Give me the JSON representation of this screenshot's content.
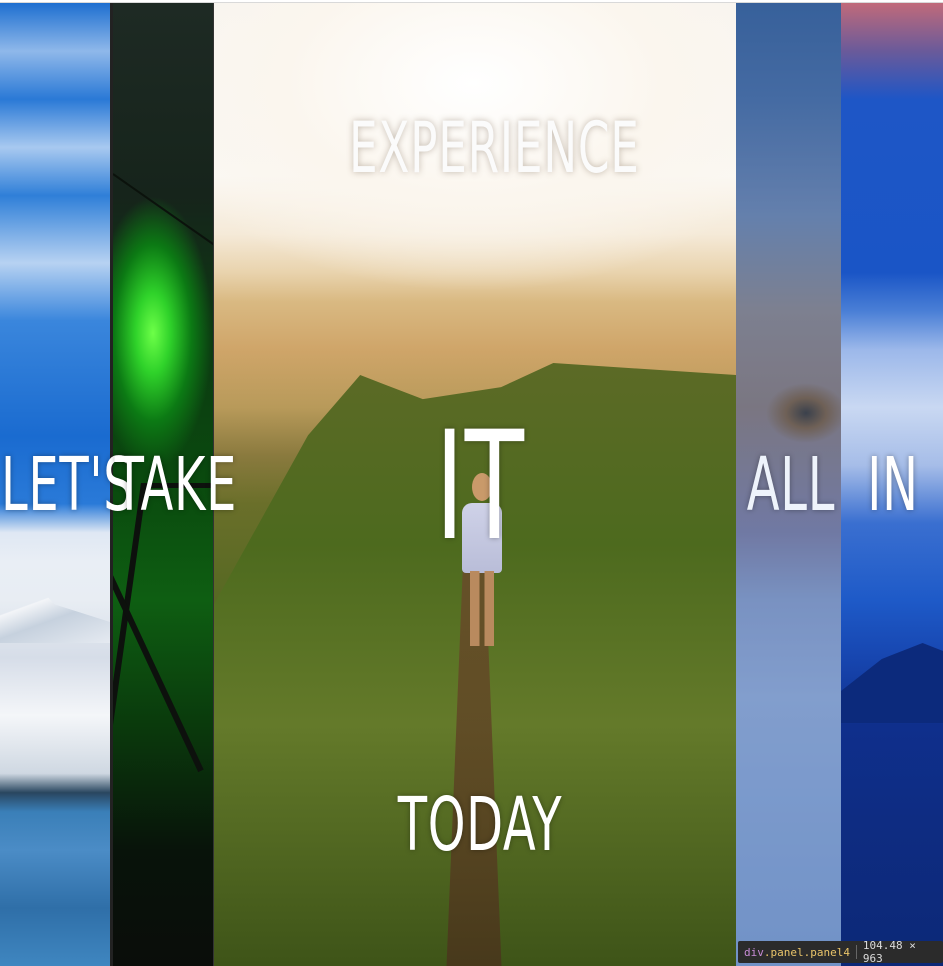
{
  "words": {
    "lets": "LET'S",
    "take": "TAKE",
    "experience": "EXPERIENCE",
    "it": "IT",
    "today": "TODAY",
    "all": "ALL",
    "in": "IN"
  },
  "inspector_tooltip": {
    "element_tag": "div",
    "element_classes": ".panel.panel4",
    "dimensions": "104.48 × 963"
  },
  "panels": [
    {
      "name": "panel1",
      "image": "blue sky, snowy mountain and lake"
    },
    {
      "name": "panel2",
      "image": "green aurora behind power tower"
    },
    {
      "name": "panel3",
      "image": "hiker on grassy mountain ridge at sunrise"
    },
    {
      "name": "panel4",
      "image": "fox face close-up with blue overlay"
    },
    {
      "name": "panel5",
      "image": "blue sky above clouds and hills"
    }
  ],
  "colors": {
    "text": "#ffffff",
    "tooltip_bg": "#2b2b2b",
    "tooltip_tag": "#c78bd6",
    "tooltip_class": "#e9c46a"
  }
}
